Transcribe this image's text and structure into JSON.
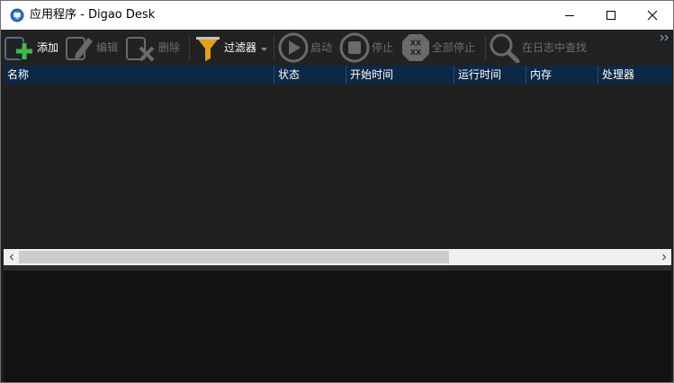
{
  "window": {
    "title": "应用程序 - Digao Desk",
    "controls": {
      "minimize": "minimize",
      "maximize": "maximize",
      "close": "close"
    }
  },
  "toolbar": {
    "add": "添加",
    "edit": "编辑",
    "delete": "删除",
    "filter": "过滤器",
    "start": "启动",
    "stop": "停止",
    "stop_all": "全部停止",
    "find_in_log": "在日志中查找"
  },
  "list": {
    "columns": [
      "名称",
      "状态",
      "开始时间",
      "运行时间",
      "内存",
      "处理器"
    ],
    "rows": []
  },
  "colors": {
    "background": "#202020",
    "header": "#0d2847",
    "add_plus": "#3fb850",
    "filter_funnel": "#e2a019",
    "log_area": "#121212"
  },
  "icons": {
    "add": "add-icon",
    "edit": "edit-icon",
    "delete": "delete-icon",
    "filter": "filter-icon",
    "start": "play-icon",
    "stop": "stop-icon",
    "stop_all": "stop-all-icon",
    "find": "search-icon"
  }
}
